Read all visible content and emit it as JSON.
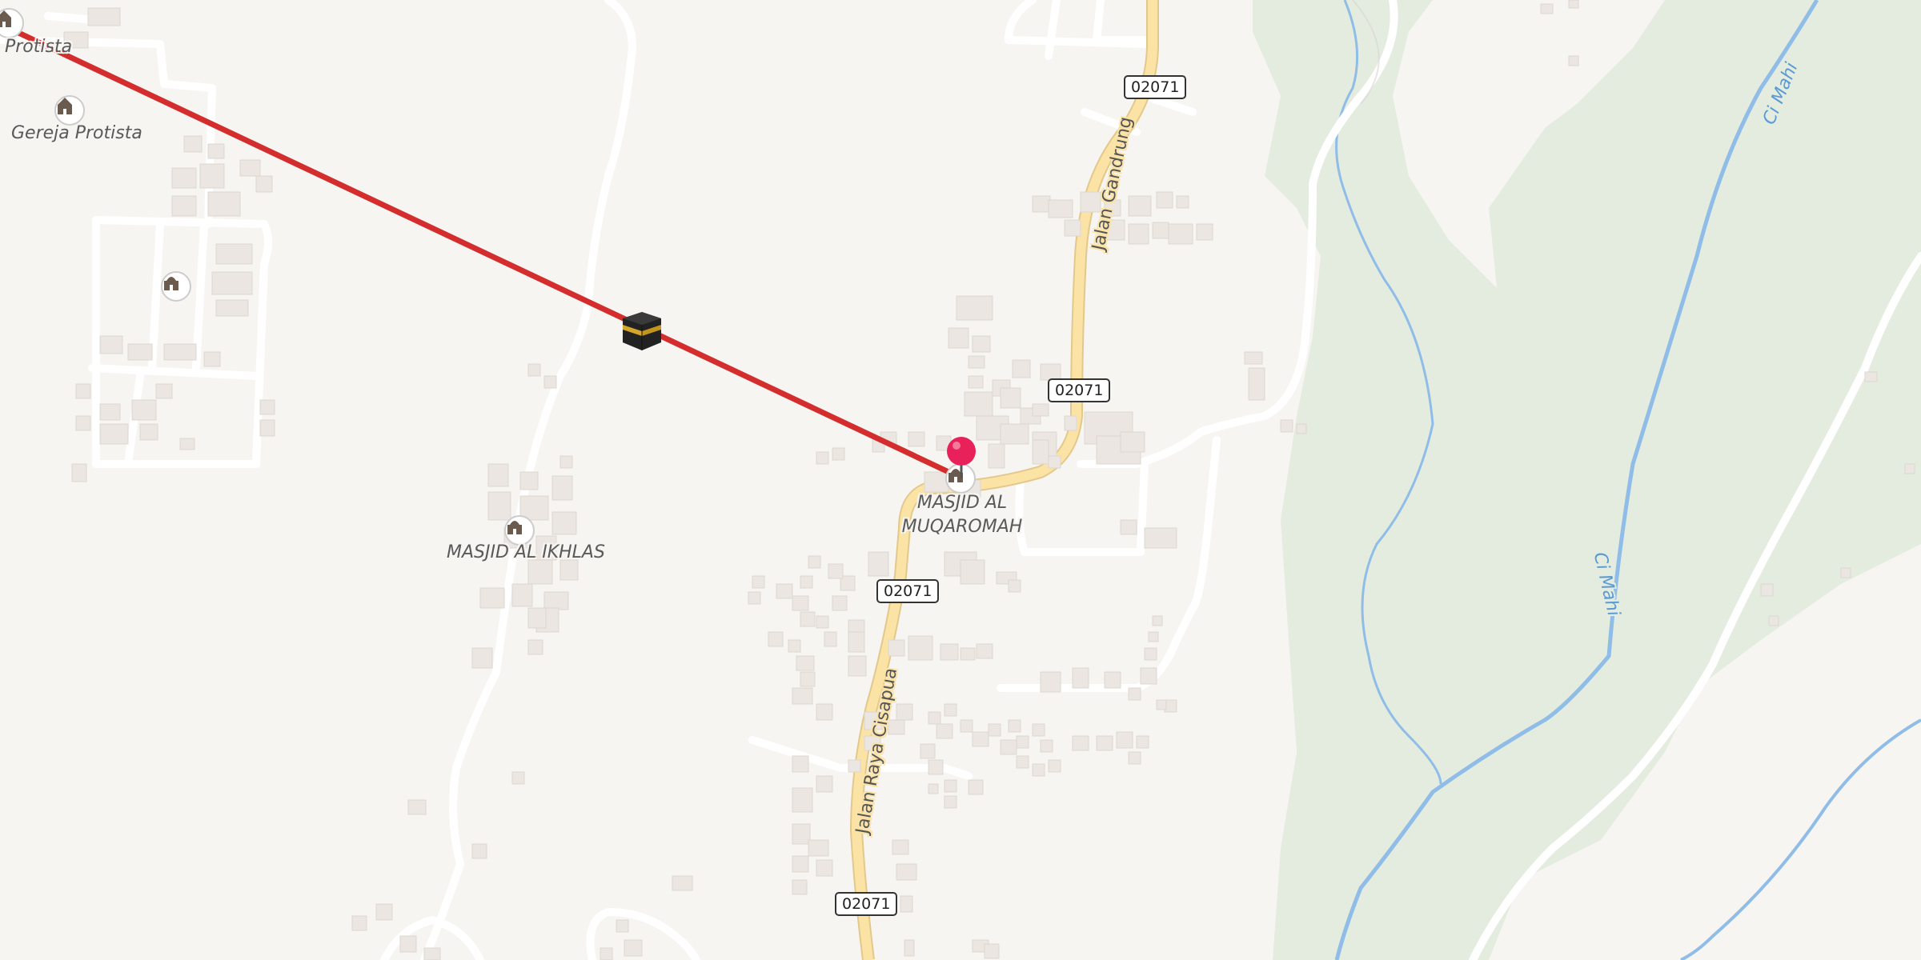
{
  "map": {
    "places": {
      "gereja_protista": "Gereja Protista",
      "protista_partial": "Protista",
      "masjid_al_ikhlas": "MASJID AL IKHLAS",
      "masjid_al_muqaromah_line1": "MASJID AL",
      "masjid_al_muqaromah_line2": "MUQAROMAH"
    },
    "roads": {
      "shield_ref": "02071",
      "jalan_gandrung": "Jalan Gandrung",
      "jalan_raya_cisapua": "Jalan Raya Cisapua"
    },
    "water": {
      "river_name": "Ci Mahi"
    },
    "icons": {
      "poi": "mosque-icon",
      "church": "church-icon",
      "kaaba": "kaaba-icon",
      "location_pin": "location-pin-icon"
    },
    "colors": {
      "qibla_line": "#d42d2d",
      "main_road": "#fbe3a6",
      "pin": "#e8215a",
      "river": "#8fbde8",
      "green_area": "#e4ecdf"
    }
  }
}
